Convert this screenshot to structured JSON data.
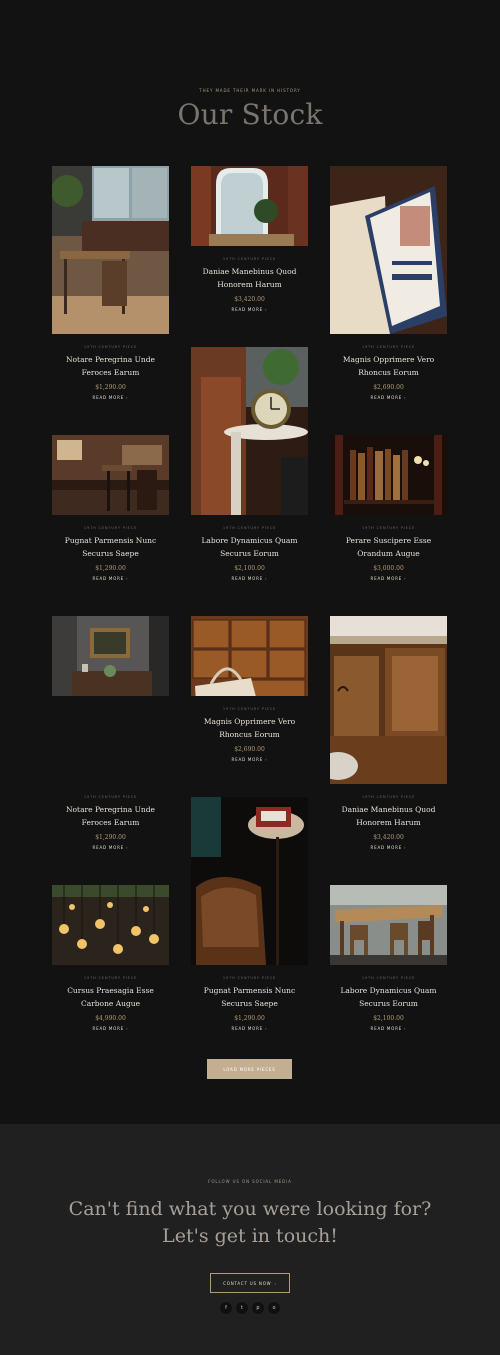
{
  "stock": {
    "kicker": "They made their mark in history",
    "heading": "Our Stock",
    "load_more": "Load More Pieces"
  },
  "products": [
    {
      "tag": "19th Century Piece",
      "title": "Notare Peregrina Unde Feroces Earum",
      "price": "$1,290.00",
      "more": "Read More",
      "image": "dining-room"
    },
    {
      "tag": "19th Century Piece",
      "title": "Daniae Manebinus Quod Honorem Harum",
      "price": "$3,420.00",
      "more": "Read More",
      "image": "mirror-plant"
    },
    {
      "tag": "19th Century Piece",
      "title": "Magnis Opprimere Vero Rhoncus Eorum",
      "price": "$2,690.00",
      "more": "Read More",
      "image": "antique-book"
    },
    {
      "tag": "19th Century Piece",
      "title": "Pugnat Parmensis Nunc Securus Saepe",
      "price": "$1,290.00",
      "more": "Read More",
      "image": "wood-interior"
    },
    {
      "tag": "19th Century Piece",
      "title": "Labore Dynamicus Quam Securus Eorum",
      "price": "$2,100.00",
      "more": "Read More",
      "image": "clock-armchair"
    },
    {
      "tag": "19th Century Piece",
      "title": "Perare Suscipere Esse Orandum Augue",
      "price": "$3,000.00",
      "more": "Read More",
      "image": "bookshelf"
    },
    {
      "tag": "19th Century Piece",
      "title": "Notare Peregrina Unde Feroces Earum",
      "price": "$1,290.00",
      "more": "Read More",
      "image": "wall-painting"
    },
    {
      "tag": "19th Century Piece",
      "title": "Magnis Opprimere Vero Rhoncus Eorum",
      "price": "$2,690.00",
      "more": "Read More",
      "image": "drawers-bag"
    },
    {
      "tag": "19th Century Piece",
      "title": "Daniae Manebinus Quod Honorem Harum",
      "price": "$3,420.00",
      "more": "Read More",
      "image": "carved-cabinet"
    },
    {
      "tag": "19th Century Piece",
      "title": "Pugnat Parmensis Nunc Securus Saepe",
      "price": "$1,290.00",
      "more": "Read More",
      "image": "leather-chair-phone"
    },
    {
      "tag": "19th Century Piece",
      "title": "Cursus Praesagia Esse Carbone Augue",
      "price": "$4,990.00",
      "more": "Read More",
      "image": "edison-bulbs"
    },
    {
      "tag": "19th Century Piece",
      "title": "Labore Dynamicus Quam Securus Eorum",
      "price": "$2,100.00",
      "more": "Read More",
      "image": "wood-table"
    }
  ],
  "contact": {
    "kicker": "Follow us on social media",
    "line1": "Can't find what you were looking for?",
    "line2": "Let's get in touch!",
    "button": "Contact Us Now",
    "socials": [
      {
        "icon": "facebook-icon",
        "glyph": "f"
      },
      {
        "icon": "twitter-icon",
        "glyph": "t"
      },
      {
        "icon": "pinterest-icon",
        "glyph": "p"
      },
      {
        "icon": "instagram-icon",
        "glyph": "o"
      }
    ]
  }
}
